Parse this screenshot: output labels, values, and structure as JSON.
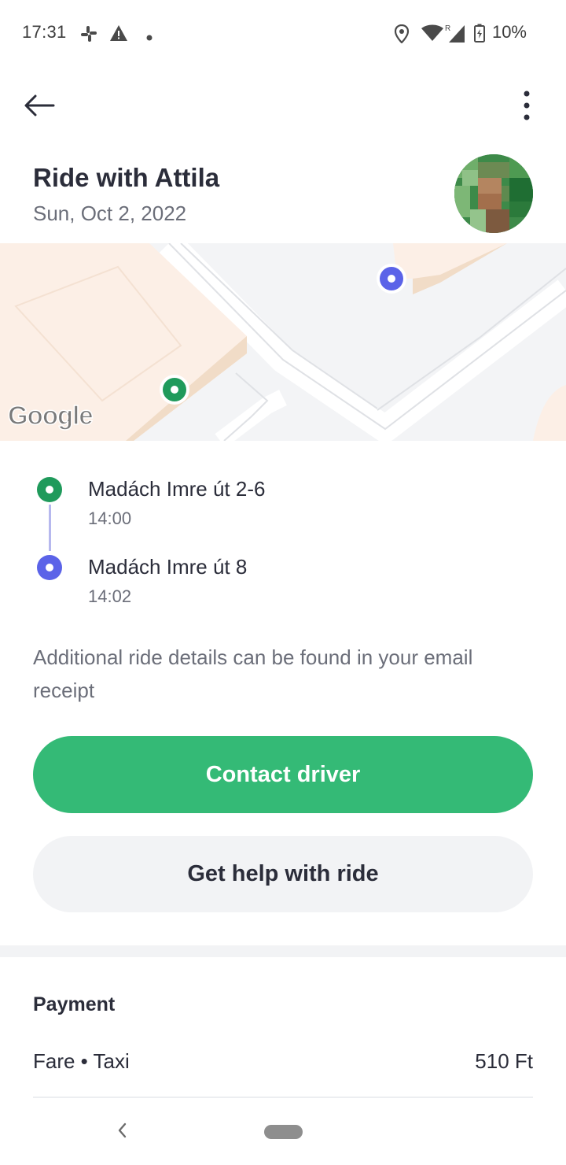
{
  "status_bar": {
    "time": "17:31",
    "battery": "10%",
    "icons": [
      "slack-icon",
      "warning-icon",
      "dot-icon",
      "location-icon",
      "wifi-icon",
      "signal-icon",
      "battery-charging-icon"
    ]
  },
  "header": {
    "back_icon": "arrow-left-icon",
    "menu_icon": "more-vertical-icon",
    "title": "Ride with Attila",
    "date": "Sun, Oct 2, 2022"
  },
  "map": {
    "attribution": "Google"
  },
  "route": {
    "stops": [
      {
        "name": "Madách Imre út 2-6",
        "time": "14:00",
        "color": "#1f9a5b"
      },
      {
        "name": "Madách Imre út 8",
        "time": "14:02",
        "color": "#5b63e8"
      }
    ]
  },
  "details_note": "Additional ride details can be found in your email receipt",
  "buttons": {
    "contact": "Contact driver",
    "help": "Get help with ride"
  },
  "payment": {
    "title": "Payment",
    "fare_label": "Fare • Taxi",
    "fare_value": "510 Ft"
  },
  "colors": {
    "accent_green": "#34ba76",
    "route_green": "#1f9a5b",
    "route_blue": "#5b63e8"
  }
}
